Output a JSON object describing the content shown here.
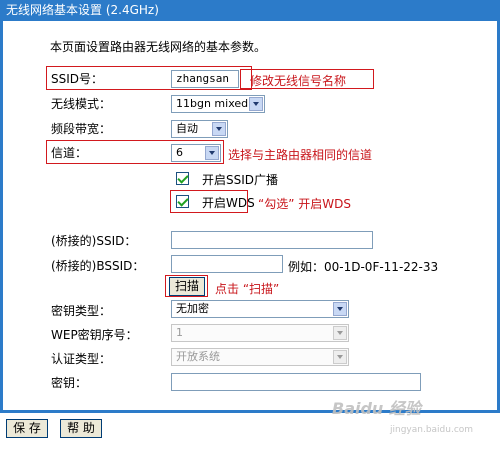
{
  "title": "无线网络基本设置 (2.4GHz)",
  "description": "本页面设置路由器无线网络的基本参数。",
  "fields": {
    "ssid": {
      "label": "SSID号：",
      "value": "zhangsan",
      "note": "修改无线信号名称"
    },
    "mode": {
      "label": "无线模式：",
      "value": "11bgn mixed"
    },
    "bandwidth": {
      "label": "频段带宽：",
      "value": "自动"
    },
    "channel": {
      "label": "信道：",
      "value": "6",
      "note": "选择与主路由器相同的信道"
    },
    "ssid_broadcast": {
      "label": "开启SSID广播",
      "checked": true
    },
    "wds": {
      "label": "开启WDS",
      "checked": true,
      "note": "“勾选” 开启WDS"
    },
    "bridge_ssid": {
      "label": "(桥接的)SSID：",
      "value": ""
    },
    "bridge_bssid": {
      "label": "(桥接的)BSSID：",
      "value": "",
      "example": "例如：00-1D-0F-11-22-33"
    },
    "scan": {
      "label": "扫描",
      "note": "点击 “扫描”"
    },
    "key_type": {
      "label": "密钥类型：",
      "value": "无加密"
    },
    "wep_index": {
      "label": "WEP密钥序号：",
      "value": "1"
    },
    "auth_type": {
      "label": "认证类型：",
      "value": "开放系统"
    },
    "key": {
      "label": "密钥：",
      "value": ""
    }
  },
  "buttons": {
    "save": "保 存",
    "help": "帮 助"
  },
  "watermark": {
    "logo": "Baidu 经验",
    "url": "jingyan.baidu.com"
  },
  "colors": {
    "frame": "#2c7bc9",
    "highlight": "#d2191e",
    "note": "#c8141a"
  }
}
